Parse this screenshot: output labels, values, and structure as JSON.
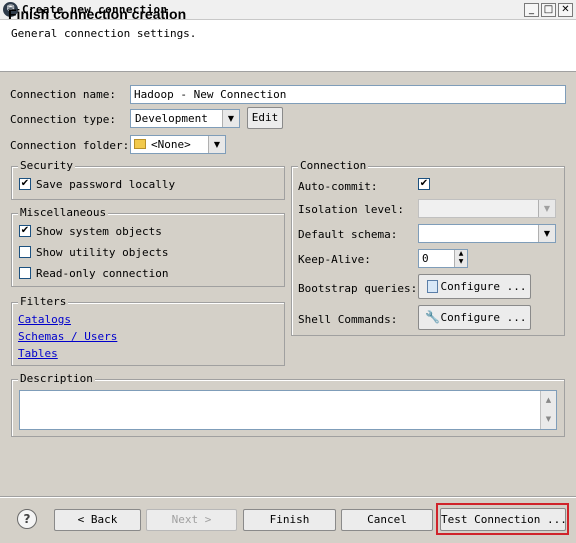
{
  "window": {
    "title": "Create new connection",
    "min_glyph": "_",
    "max_glyph": "□",
    "close_glyph": "✕"
  },
  "header": {
    "title": "Finish connection creation",
    "subtitle": "General connection settings."
  },
  "form": {
    "name_label": "Connection name:",
    "name_value": "Hadoop - New Connection",
    "type_label": "Connection type:",
    "type_value": "Development",
    "edit_label": "Edit",
    "folder_label": "Connection folder:",
    "folder_value": "<None>"
  },
  "security": {
    "title": "Security",
    "save_password": {
      "label": "Save password locally",
      "checked": true
    }
  },
  "misc": {
    "title": "Miscellaneous",
    "items": [
      {
        "label": "Show system objects",
        "checked": true
      },
      {
        "label": "Show utility objects",
        "checked": false
      },
      {
        "label": "Read-only connection",
        "checked": false
      }
    ]
  },
  "filters": {
    "title": "Filters",
    "links": [
      "Catalogs",
      "Schemas / Users",
      "Tables"
    ]
  },
  "connection": {
    "title": "Connection",
    "auto_commit_label": "Auto-commit:",
    "auto_commit_checked": true,
    "isolation_label": "Isolation level:",
    "isolation_value": "",
    "schema_label": "Default schema:",
    "schema_value": "",
    "keepalive_label": "Keep-Alive:",
    "keepalive_value": "0",
    "bootstrap_label": "Bootstrap queries:",
    "bootstrap_button": "Configure ...",
    "shell_label": "Shell Commands:",
    "shell_button": "Configure ..."
  },
  "description": {
    "title": "Description",
    "value": ""
  },
  "footer": {
    "help_glyph": "?",
    "back": "< Back",
    "next": "Next >",
    "finish": "Finish",
    "cancel": "Cancel",
    "test": "Test Connection ..."
  }
}
